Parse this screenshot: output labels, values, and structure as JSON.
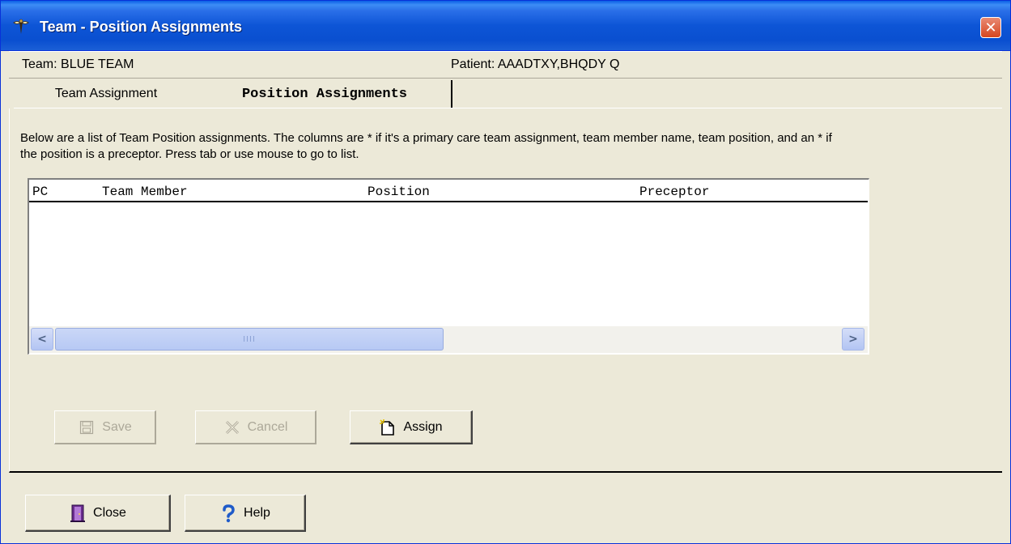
{
  "window": {
    "title": "Team - Position Assignments",
    "close_glyph": "✕"
  },
  "info": {
    "team": "Team: BLUE TEAM",
    "patient": "Patient: AAADTXY,BHQDY Q"
  },
  "tabs": [
    {
      "label": "Team Assignment",
      "selected": false
    },
    {
      "label": "Position Assignments",
      "selected": true
    }
  ],
  "description": "Below are a list of Team Position assignments.  The columns are * if it's a primary care team assignment, team member name, team position, and an * if the position is a preceptor.  Press tab or use mouse to go to list.",
  "list": {
    "columns": [
      "PC",
      "Team Member",
      "Position",
      "Preceptor"
    ],
    "rows": [],
    "scroll_left": "<",
    "scroll_right": ">",
    "thumb_grip": "IIII"
  },
  "buttons": {
    "save": {
      "label": "Save",
      "icon": "floppy-disk-icon",
      "enabled": false
    },
    "cancel": {
      "label": "Cancel",
      "icon": "cancel-x-icon",
      "enabled": false
    },
    "assign": {
      "label": "Assign",
      "icon": "new-document-icon",
      "enabled": true
    },
    "close": {
      "label": "Close",
      "icon": "door-exit-icon",
      "enabled": true
    },
    "help": {
      "label": "Help",
      "icon": "question-mark-icon",
      "enabled": true
    }
  },
  "colors": {
    "titlebar": "#0a55d6",
    "face": "#ece9d8",
    "close_red": "#d6461f",
    "help_blue": "#1f5bc9",
    "disabled_text": "#aca899"
  }
}
